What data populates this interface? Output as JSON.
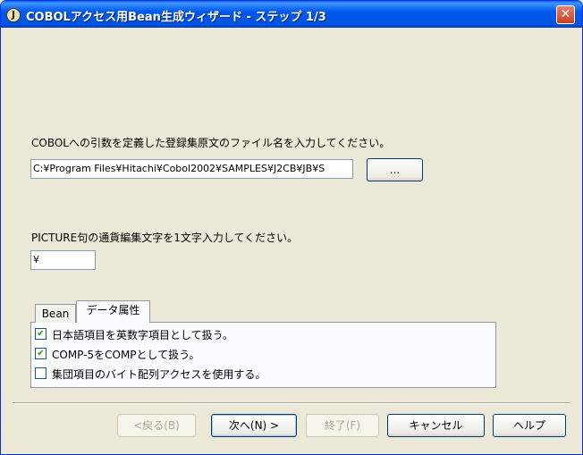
{
  "window": {
    "title": "COBOLアクセス用Bean生成ウィザード - ステップ 1/3",
    "app_icon_glyph": "J",
    "close_glyph": "✕"
  },
  "file_section": {
    "prompt": "COBOLへの引数を定義した登録集原文のファイル名を入力してください。",
    "path_value": "C:¥Program Files¥Hitachi¥Cobol2002¥SAMPLES¥J2CB¥JB¥S",
    "browse_label": "..."
  },
  "currency_section": {
    "prompt": "PICTURE句の通貨編集文字を1文字入力してください。",
    "value": "¥"
  },
  "tabs": [
    {
      "label": "Bean",
      "active": false
    },
    {
      "label": "データ属性",
      "active": true
    }
  ],
  "options": [
    {
      "label": "日本語項目を英数字項目として扱う。",
      "checked": true
    },
    {
      "label": "COMP-5をCOMPとして扱う。",
      "checked": true
    },
    {
      "label": "集団項目のバイト配列アクセスを使用する。",
      "checked": false
    }
  ],
  "buttons": {
    "back": "<戻る(B)",
    "next": "次へ(N) >",
    "finish": "終了(F)",
    "cancel": "キャンセル",
    "help": "ヘルプ"
  },
  "colors": {
    "dialog_bg": "#ECE9D8",
    "titlebar": "#0054E3",
    "close_button": "#C8401E"
  }
}
